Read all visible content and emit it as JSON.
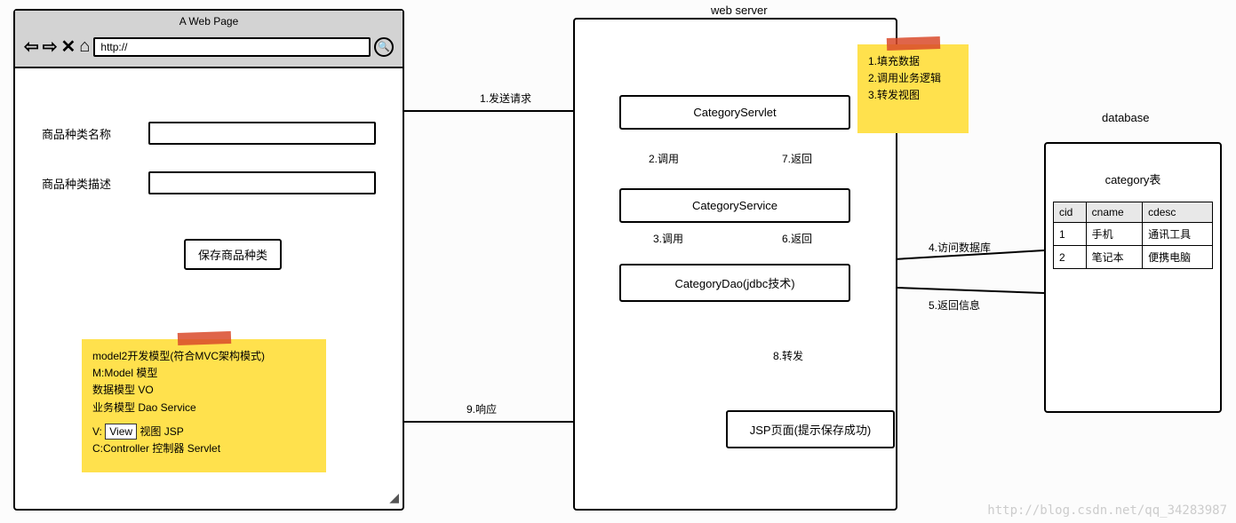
{
  "browser": {
    "title": "A Web Page",
    "url": "http://",
    "form": {
      "label_name": "商品种类名称",
      "label_desc": "商品种类描述",
      "submit": "保存商品种类"
    }
  },
  "sticky_left": {
    "line1": "model2开发模型(符合MVC架构模式)",
    "line2": "M:Model 模型",
    "line3": "数据模型 VO",
    "line4": "业务模型 Dao Service",
    "line5_prefix": "V: ",
    "line5_box": "View",
    "line5_suffix": " 视图 JSP",
    "line6": "C:Controller 控制器   Servlet"
  },
  "server": {
    "label": "web server",
    "servlet": "CategoryServlet",
    "service": "CategoryService",
    "dao": "CategoryDao(jdbc技术)",
    "jsp": "JSP页面(提示保存成功)"
  },
  "sticky_right": {
    "line1": "1.填充数据",
    "line2": "2.调用业务逻辑",
    "line3": "3.转发视图"
  },
  "database": {
    "label": "database",
    "table_name": "category表",
    "columns": [
      "cid",
      "cname",
      "cdesc"
    ],
    "rows": [
      [
        "1",
        "手机",
        "通讯工具"
      ],
      [
        "2",
        "笔记本",
        "便携电脑"
      ]
    ]
  },
  "flows": {
    "f1": "1.发送请求",
    "f2": "2.调用",
    "f3": "3.调用",
    "f4": "4.访问数据库",
    "f5": "5.返回信息",
    "f6": "6.返回",
    "f7": "7.返回",
    "f8": "8.转发",
    "f9": "9.响应"
  },
  "watermark": "http://blog.csdn.net/qq_34283987"
}
